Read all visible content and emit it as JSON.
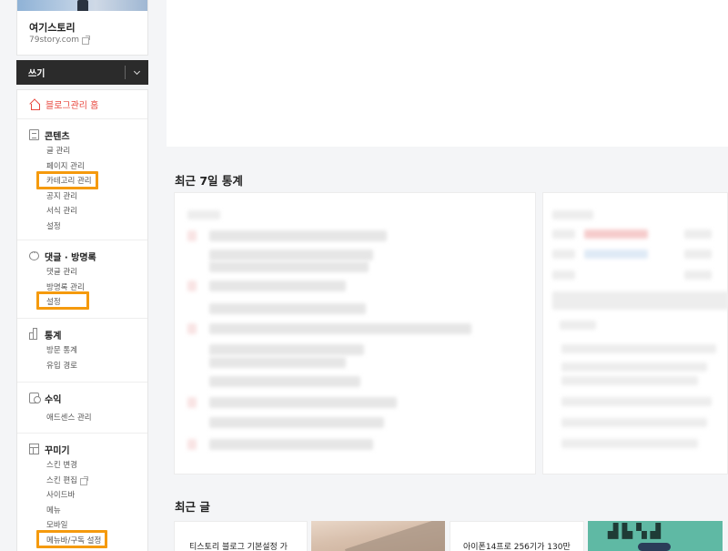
{
  "blog": {
    "name": "여기스토리",
    "url": "79story.com"
  },
  "write": {
    "label": "쓰기"
  },
  "menu": {
    "home": "블로그관리 홈",
    "sections": [
      {
        "title": "콘텐츠",
        "items": [
          "글 관리",
          "페이지 관리",
          "카테고리 관리",
          "공지 관리",
          "서식 관리",
          "설정"
        ]
      },
      {
        "title": "댓글 · 방명록",
        "items": [
          "댓글 관리",
          "방명록 관리",
          "설정"
        ]
      },
      {
        "title": "통계",
        "items": [
          "방문 통계",
          "유입 경로"
        ]
      },
      {
        "title": "수익",
        "items": [
          "애드센스 관리"
        ]
      },
      {
        "title": "꾸미기",
        "items": [
          "스킨 변경",
          "스킨 편집",
          "사이드바",
          "메뉴",
          "모바일",
          "메뉴바/구독 설정"
        ]
      }
    ]
  },
  "main": {
    "stats_heading": "최근 7일 통계",
    "recent_heading": "최근 글",
    "posts": [
      {
        "title": "티스토리 블로그 기본설정 가"
      },
      {
        "title": "아이폰14프로 256기가 130만"
      }
    ]
  },
  "highlight_color": "#f59a0d"
}
